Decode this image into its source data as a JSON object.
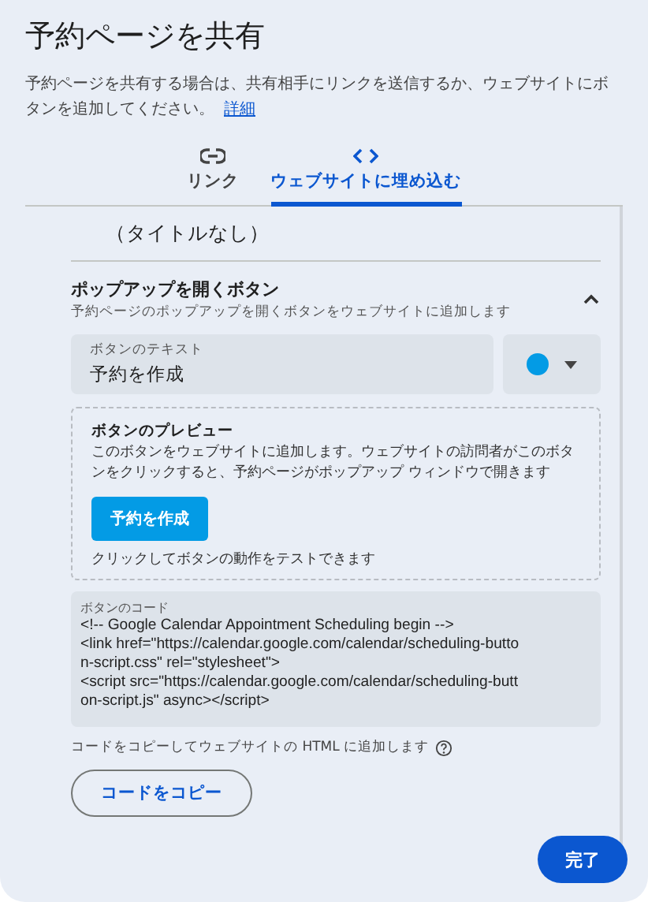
{
  "dialog": {
    "title": "予約ページを共有",
    "description": "予約ページを共有する場合は、共有相手にリンクを送信するか、ウェブサイトにボタンを追加してください。",
    "learn_more": "詳細"
  },
  "tabs": [
    {
      "label": "リンク",
      "selected": false
    },
    {
      "label": "ウェブサイトに埋め込む",
      "selected": true
    }
  ],
  "page_title": "（タイトルなし）",
  "section": {
    "title": "ポップアップを開くボタン",
    "subtitle": "予約ページのポップアップを開くボタンをウェブサイトに追加します",
    "expanded": true
  },
  "button_text_field": {
    "label": "ボタンのテキスト",
    "value": "予約を作成"
  },
  "color_picker": {
    "color": "#039be5"
  },
  "preview": {
    "title": "ボタンのプレビュー",
    "description": "このボタンをウェブサイトに追加します。ウェブサイトの訪問者がこのボタンをクリックすると、予約ページがポップアップ ウィンドウで開きます",
    "button": "予約を作成",
    "hint": "クリックしてボタンの動作をテストできます"
  },
  "code": {
    "label": "ボタンのコード",
    "lines": [
      "<!-- Google Calendar Appointment Scheduling begin -->",
      "<link href=\"https://calendar.google.com/calendar/scheduling-butto",
      "n-script.css\" rel=\"stylesheet\">",
      "<script src=\"https://calendar.google.com/calendar/scheduling-butt",
      "on-script.js\" async></script>"
    ]
  },
  "copy_hint": "コードをコピーしてウェブサイトの HTML に追加します",
  "copy_button": "コードをコピー",
  "done_button": "完了"
}
